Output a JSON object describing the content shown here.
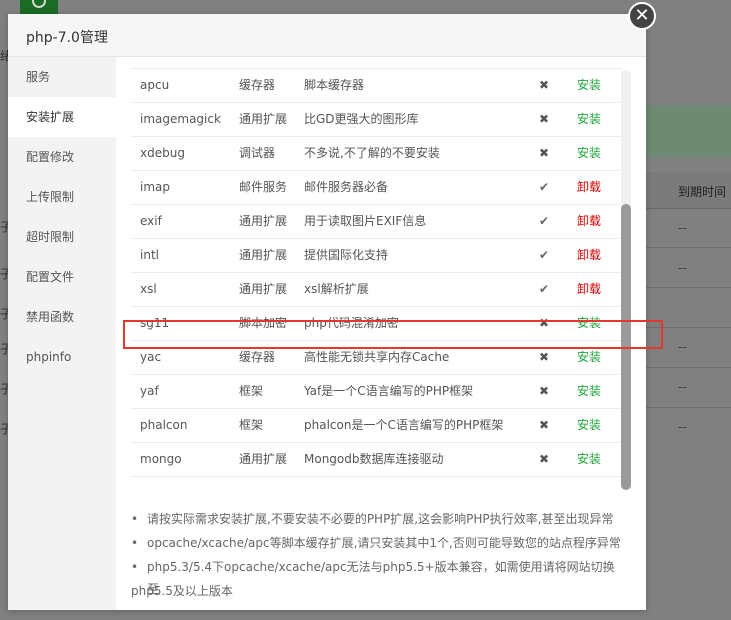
{
  "background": {
    "column_header": "到期时间",
    "row_values": [
      "--",
      "--",
      "--",
      "--",
      "--"
    ],
    "left_chars": [
      "绪",
      "子",
      "子",
      "子",
      "子",
      "子",
      "子"
    ]
  },
  "modal": {
    "title": "php-7.0管理",
    "close_label": "✕"
  },
  "sidebar": {
    "items": [
      {
        "label": "服务"
      },
      {
        "label": "安装扩展"
      },
      {
        "label": "配置修改"
      },
      {
        "label": "上传限制"
      },
      {
        "label": "超时限制"
      },
      {
        "label": "配置文件"
      },
      {
        "label": "禁用函数"
      },
      {
        "label": "phpinfo"
      }
    ],
    "active_index": 1
  },
  "extensions": [
    {
      "name": "apcu",
      "type": "缓存器",
      "desc": "脚本缓存器",
      "status": "✖",
      "installed": false,
      "action": "安装"
    },
    {
      "name": "imagemagick",
      "type": "通用扩展",
      "desc": "比GD更强大的图形库",
      "status": "✖",
      "installed": false,
      "action": "安装"
    },
    {
      "name": "xdebug",
      "type": "调试器",
      "desc": "不多说,不了解的不要安装",
      "status": "✖",
      "installed": false,
      "action": "安装"
    },
    {
      "name": "imap",
      "type": "邮件服务",
      "desc": "邮件服务器必备",
      "status": "✔",
      "installed": true,
      "action": "卸载"
    },
    {
      "name": "exif",
      "type": "通用扩展",
      "desc": "用于读取图片EXIF信息",
      "status": "✔",
      "installed": true,
      "action": "卸载"
    },
    {
      "name": "intl",
      "type": "通用扩展",
      "desc": "提供国际化支持",
      "status": "✔",
      "installed": true,
      "action": "卸载"
    },
    {
      "name": "xsl",
      "type": "通用扩展",
      "desc": "xsl解析扩展",
      "status": "✔",
      "installed": true,
      "action": "卸载"
    },
    {
      "name": "sg11",
      "type": "脚本加密",
      "desc": "php代码混淆加密",
      "status": "✖",
      "installed": false,
      "action": "安装"
    },
    {
      "name": "yac",
      "type": "缓存器",
      "desc": "高性能无锁共享内存Cache",
      "status": "✖",
      "installed": false,
      "action": "安装"
    },
    {
      "name": "yaf",
      "type": "框架",
      "desc": "Yaf是一个C语言编写的PHP框架",
      "status": "✖",
      "installed": false,
      "action": "安装"
    },
    {
      "name": "phalcon",
      "type": "框架",
      "desc": "phalcon是一个C语言编写的PHP框架",
      "status": "✖",
      "installed": false,
      "action": "安装"
    },
    {
      "name": "mongo",
      "type": "通用扩展",
      "desc": "Mongodb数据库连接驱动",
      "status": "✖",
      "installed": false,
      "action": "安装"
    }
  ],
  "highlighted_extension": "sg11",
  "notes": [
    {
      "text": "请按实际需求安装扩展,不要安装不必要的PHP扩展,这会影响PHP执行效率,甚至出现异常"
    },
    {
      "text": "opcache/xcache/apc等脚本缓存扩展,请只安装其中1个,否则可能导致您的站点程序异常"
    },
    {
      "text": "php5.3/5.4下opcache/xcache/apc无法与php5.5+版本兼容，如需使用请将网站切换至",
      "cont": "php5.5及以上版本"
    }
  ],
  "colors": {
    "install": "#20a53a",
    "uninstall": "#d60000",
    "highlight_border": "#e0392f"
  }
}
